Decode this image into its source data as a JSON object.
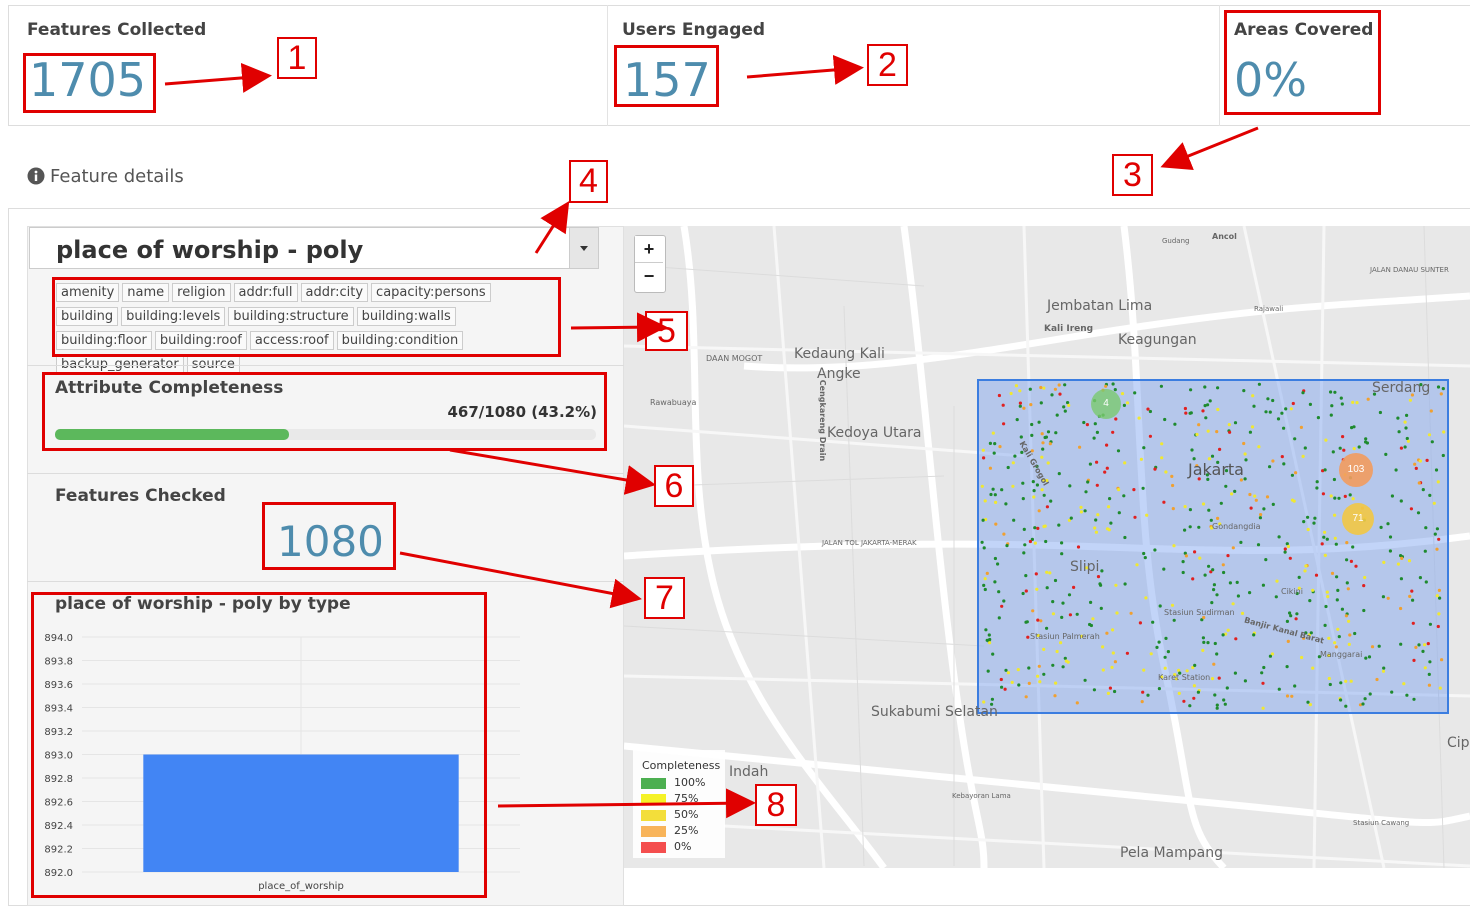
{
  "stats": {
    "features_collected": {
      "title": "Features Collected",
      "value": "1705"
    },
    "users_engaged": {
      "title": "Users Engaged",
      "value": "157"
    },
    "areas_covered": {
      "title": "Areas Covered",
      "value": "0%"
    }
  },
  "details": {
    "header_icon": "info-circle-icon",
    "header_title": "Feature details",
    "feature_select": {
      "selected": "place of worship - poly",
      "icon": "caret-down-icon"
    },
    "tags": [
      "amenity",
      "name",
      "religion",
      "addr:full",
      "addr:city",
      "capacity:persons",
      "building",
      "building:levels",
      "building:structure",
      "building:walls",
      "building:floor",
      "building:roof",
      "access:roof",
      "building:condition",
      "backup_generator",
      "source"
    ],
    "attribute_completeness": {
      "title": "Attribute Completeness",
      "text": "467/1080 (43.2%)",
      "fraction": 0.432
    },
    "features_checked": {
      "title": "Features Checked",
      "value": "1080"
    },
    "chart_title": "place of worship - poly by type"
  },
  "chart_data": {
    "type": "bar",
    "title": "place of worship - poly by type",
    "categories": [
      "place_of_worship"
    ],
    "values": [
      893.0
    ],
    "ylim": [
      892.0,
      894.0
    ],
    "yticks": [
      "894.0",
      "893.8",
      "893.6",
      "893.4",
      "893.2",
      "893.0",
      "892.8",
      "892.6",
      "892.4",
      "892.2",
      "892.0"
    ],
    "bar_color": "#4285f4",
    "grid": true
  },
  "map": {
    "zoom_in": "+",
    "zoom_out": "−",
    "labels": {
      "jembatan_lima": "Jembatan Lima",
      "kali_ireng": "Kali Ireng",
      "keagungan": "Keagungan",
      "kedaung": "Kedaung Kali",
      "angke": "Angke",
      "kedoya": "Kedoya Utara",
      "jakarta": "Jakarta",
      "serdang": "Serdang",
      "slipi": "Slipi",
      "sukabumi": "Sukabumi Selatan",
      "indah": "Indah",
      "pela": "Pela Mampang",
      "cip": "Cip",
      "daan_mogot": "DAAN MOGOT",
      "rawabuaya": "Rawabuaya",
      "gondangdia": "Gondangdia",
      "cikini": "Cikini",
      "sudirman": "Stasiun Sudirman",
      "palmerah": "Stasiun Palmerah",
      "karet": "Karet Station",
      "manggarai": "Manggarai",
      "kebayoran": "Kebayoran Lama",
      "cawang": "Stasiun Cawang",
      "kebon": "JALAN TOL JAKARTA-MERAK",
      "danau_sunter": "JALAN DANAU SUNTER",
      "gudang": "Gudang",
      "ancol": "Ancol",
      "rajawali": "Rajawali",
      "banjir": "Banjir Kanal Barat",
      "gajah": "Kali Grogol",
      "cengkareng": "Cengkareng Drain"
    },
    "clusters": [
      {
        "label": "4",
        "color": "#7bc96f"
      },
      {
        "label": "103",
        "color": "#f29b5e"
      },
      {
        "label": "71",
        "color": "#f2c744"
      }
    ],
    "legend": {
      "title": "Completeness",
      "items": [
        {
          "label": "100%",
          "color": "#4caf50"
        },
        {
          "label": "75%",
          "color": "#f5f227"
        },
        {
          "label": "50%",
          "color": "#f3de3a"
        },
        {
          "label": "25%",
          "color": "#f8b45a"
        },
        {
          "label": "0%",
          "color": "#f44e4e"
        }
      ]
    }
  },
  "annotations": [
    "1",
    "2",
    "3",
    "4",
    "5",
    "6",
    "7",
    "8"
  ]
}
